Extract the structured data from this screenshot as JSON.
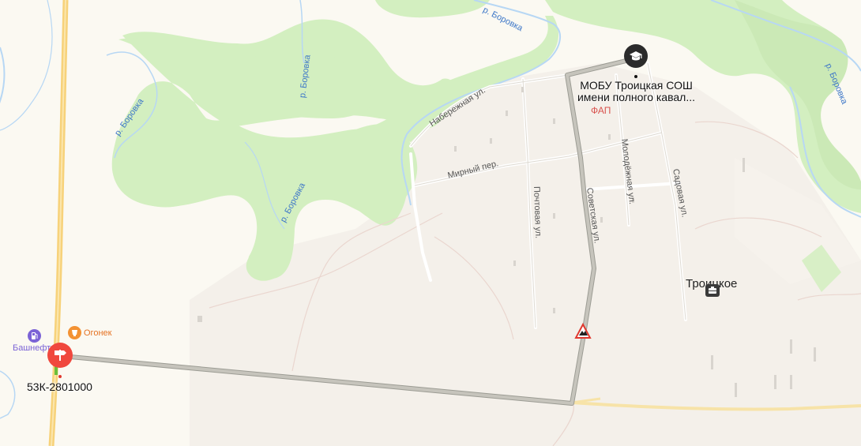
{
  "colors": {
    "background": "#fbf9f2",
    "forest": "#d3efc0",
    "forest_dark": "#cbe9b6",
    "settlement": "#f4f0ea",
    "river": "#b7d7f4",
    "highway": "#f7d27a",
    "route": "#b9b9b0",
    "route_street": "#bdbdbd",
    "pin_red": "#f0483e",
    "school_pin": "#2b2b2b",
    "fuel": "#7b63d6",
    "cafe": "#f39233"
  },
  "icons": {
    "school_pin": "graduation-cap-icon",
    "start_pin": "signpost-icon",
    "fuel": "gas-pump-icon",
    "cafe": "cup-icon",
    "settlement_badge": "briefcase-icon",
    "warning": "road-warning-icon"
  },
  "labels": {
    "school": "МОБУ Троицкая СОШ имени полного кавал...",
    "fap": "ФАП",
    "village": "Троицкое",
    "road_code": "53К-2801000",
    "fuel_station": "Башнефть",
    "cafe": "Огонек"
  },
  "streets": {
    "naberezhnaya": "Набережная ул.",
    "mirny": "Мирный пер.",
    "pochtovaya": "Почтовая ул.",
    "sovetskaya": "Советская ул.",
    "molodezhnaya": "Молодёжная ул.",
    "sadovaya": "Садовая ул."
  },
  "rivers": {
    "r1": "р. Боровка",
    "r2": "р. Боровка",
    "r3": "р. Боровка",
    "r4": "р. Боровка",
    "r5": "р. Боровка"
  }
}
